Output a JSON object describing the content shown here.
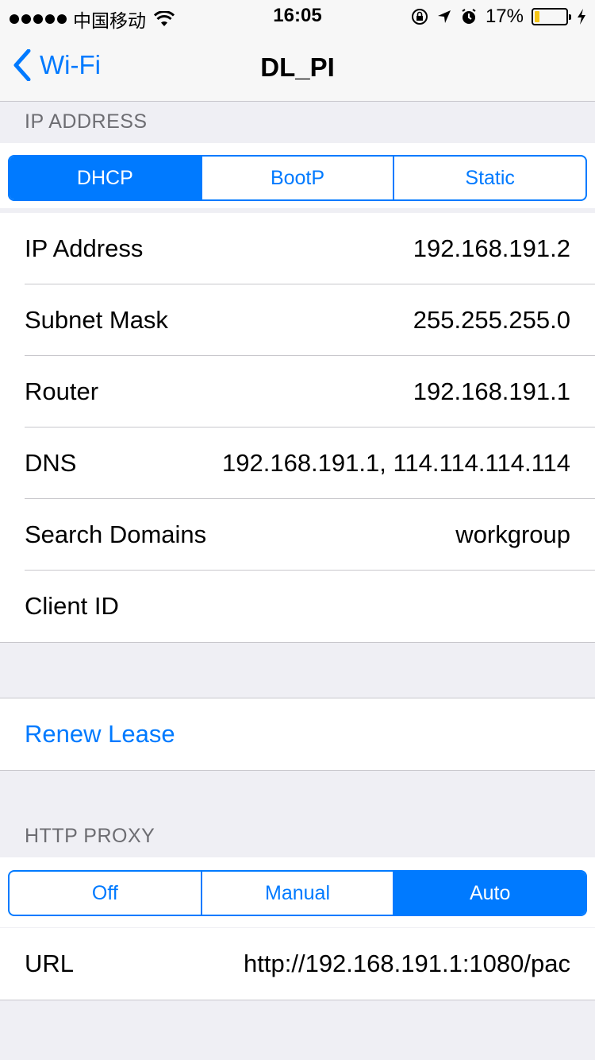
{
  "status_bar": {
    "carrier": "中国移动",
    "time": "16:05",
    "battery_percent": "17%",
    "battery_level": 0.17,
    "icons": [
      "signal-dots-icon",
      "wifi-icon",
      "orientation-lock-icon",
      "location-icon",
      "alarm-icon",
      "battery-icon",
      "charging-icon"
    ]
  },
  "nav": {
    "back_label": "Wi-Fi",
    "title": "DL_PI"
  },
  "ip_section": {
    "header": "IP ADDRESS",
    "segments": [
      "DHCP",
      "BootP",
      "Static"
    ],
    "selected": "DHCP",
    "rows": [
      {
        "label": "IP Address",
        "value": "192.168.191.2"
      },
      {
        "label": "Subnet Mask",
        "value": "255.255.255.0"
      },
      {
        "label": "Router",
        "value": "192.168.191.1"
      },
      {
        "label": "DNS",
        "value": "192.168.191.1, 114.114.114.114"
      },
      {
        "label": "Search Domains",
        "value": "workgroup"
      },
      {
        "label": "Client ID",
        "value": ""
      }
    ]
  },
  "renew": {
    "label": "Renew Lease"
  },
  "proxy_section": {
    "header": "HTTP PROXY",
    "segments": [
      "Off",
      "Manual",
      "Auto"
    ],
    "selected": "Auto",
    "url_label": "URL",
    "url_value": "http://192.168.191.1:1080/pac"
  },
  "colors": {
    "accent": "#007aff",
    "background": "#efeff4",
    "battery": "#f5c518"
  }
}
